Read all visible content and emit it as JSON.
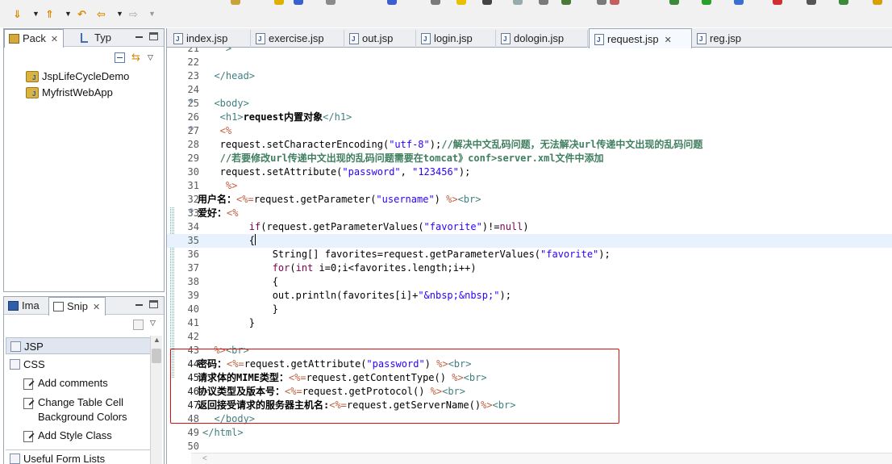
{
  "toolbar": {
    "buttons": [
      {
        "name": "skip-down-button",
        "glyph": "⇓"
      },
      {
        "name": "skip-up-button",
        "glyph": "⇑"
      },
      {
        "name": "back-button",
        "glyph": "⇦"
      },
      {
        "name": "forward-button",
        "glyph": "⇨"
      }
    ]
  },
  "left_top": {
    "tabs": [
      {
        "label": "Pack",
        "active": true,
        "close": "✕"
      },
      {
        "label": "Typ",
        "active": false
      }
    ],
    "projects": [
      "JspLifeCycleDemo",
      "MyfristWebApp"
    ]
  },
  "left_bottom": {
    "tabs": [
      {
        "label": "Ima",
        "active": false
      },
      {
        "label": "Snip",
        "active": true,
        "close": "✕"
      }
    ],
    "drawers": [
      "JSP",
      "CSS",
      "Useful Form Lists"
    ],
    "snippets": [
      "Add comments",
      "Change Table Cell Background Colors",
      "Add Style Class"
    ]
  },
  "editor": {
    "tabs": [
      {
        "label": "index.jsp",
        "active": false
      },
      {
        "label": "exercise.jsp",
        "active": false
      },
      {
        "label": "out.jsp",
        "active": false
      },
      {
        "label": "login.jsp",
        "active": false
      },
      {
        "label": "dologin.jsp",
        "active": false
      },
      {
        "label": "request.jsp",
        "active": true,
        "close": "✕"
      },
      {
        "label": "reg.jsp",
        "active": false
      }
    ],
    "lines": [
      {
        "n": "21",
        "segs": [
          [
            "tag",
            "    >"
          ]
        ]
      },
      {
        "n": "22",
        "segs": []
      },
      {
        "n": "23",
        "segs": [
          [
            "tag",
            "  </head>"
          ]
        ]
      },
      {
        "n": "24",
        "segs": []
      },
      {
        "n": "25",
        "fold": true,
        "segs": [
          [
            "tag",
            "  <body>"
          ]
        ]
      },
      {
        "n": "26",
        "segs": [
          [
            "tag",
            "   <h1>"
          ],
          [
            "txt",
            "request内置对象"
          ],
          [
            "tag",
            "</h1>"
          ]
        ]
      },
      {
        "n": "27",
        "fold": true,
        "segs": [
          [
            "pct",
            "   <%"
          ]
        ]
      },
      {
        "n": "28",
        "segs": [
          [
            "jsp",
            "   request.setCharacterEncoding("
          ],
          [
            "str",
            "\"utf-8\""
          ],
          [
            "jsp",
            ");"
          ],
          [
            "cm",
            "//解决中文乱码问题，无法解决url传递中文出现的乱码问题"
          ]
        ]
      },
      {
        "n": "29",
        "segs": [
          [
            "cm",
            "   //若要修改url传递中文出现的乱码问题需要在tomcat》conf>server.xml文件中添加"
          ]
        ]
      },
      {
        "n": "30",
        "segs": [
          [
            "jsp",
            "   request.setAttribute("
          ],
          [
            "str",
            "\"password\""
          ],
          [
            "jsp",
            ", "
          ],
          [
            "str",
            "\"123456\""
          ],
          [
            "jsp",
            ");"
          ]
        ]
      },
      {
        "n": "31",
        "segs": [
          [
            "pct",
            "    %>"
          ]
        ]
      },
      {
        "n": "32",
        "segs": [
          [
            "txt",
            "用户名："
          ],
          [
            "pct",
            "<%="
          ],
          [
            "jsp",
            "request.getParameter("
          ],
          [
            "str",
            "\"username\""
          ],
          [
            "jsp",
            ") "
          ],
          [
            "pct",
            "%>"
          ],
          [
            "tag",
            "<br>"
          ]
        ],
        "shift": -6
      },
      {
        "n": "33",
        "fold": true,
        "segs": [
          [
            "txt",
            "爱好："
          ],
          [
            "pct",
            "<%"
          ]
        ],
        "shift": -6
      },
      {
        "n": "34",
        "segs": [
          [
            "jsp",
            "        "
          ],
          [
            "kw",
            "if"
          ],
          [
            "jsp",
            "(request.getParameterValues("
          ],
          [
            "str",
            "\"favorite\""
          ],
          [
            "jsp",
            ")!="
          ],
          [
            "kw",
            "null"
          ],
          [
            "jsp",
            ")"
          ]
        ]
      },
      {
        "n": "35",
        "cur": true,
        "segs": [
          [
            "jsp",
            "        {"
          ]
        ],
        "caret": true
      },
      {
        "n": "36",
        "segs": [
          [
            "jsp",
            "            String[] favorites=request.getParameterValues("
          ],
          [
            "str",
            "\"favorite\""
          ],
          [
            "jsp",
            ");"
          ]
        ]
      },
      {
        "n": "37",
        "segs": [
          [
            "jsp",
            "            "
          ],
          [
            "kw",
            "for"
          ],
          [
            "jsp",
            "("
          ],
          [
            "kw",
            "int"
          ],
          [
            "jsp",
            " i=0;i<favorites.length;i++)"
          ]
        ]
      },
      {
        "n": "38",
        "segs": [
          [
            "jsp",
            "            {"
          ]
        ]
      },
      {
        "n": "39",
        "segs": [
          [
            "jsp",
            "            out.println(favorites[i]+"
          ],
          [
            "str",
            "\"&nbsp;&nbsp;\""
          ],
          [
            "jsp",
            ");"
          ]
        ]
      },
      {
        "n": "40",
        "segs": [
          [
            "jsp",
            "            }"
          ]
        ]
      },
      {
        "n": "41",
        "segs": [
          [
            "jsp",
            "        }"
          ]
        ]
      },
      {
        "n": "42",
        "segs": []
      },
      {
        "n": "43",
        "segs": [
          [
            "pct",
            "  %>"
          ],
          [
            "tag",
            "<br>"
          ]
        ]
      },
      {
        "n": "44",
        "dark": true,
        "segs": [
          [
            "txt",
            "密码："
          ],
          [
            "pct",
            "<%="
          ],
          [
            "jsp",
            "request.getAttribute("
          ],
          [
            "str",
            "\"password\""
          ],
          [
            "jsp",
            ") "
          ],
          [
            "pct",
            "%>"
          ],
          [
            "tag",
            "<br>"
          ]
        ],
        "shift": -6
      },
      {
        "n": "45",
        "dark": true,
        "segs": [
          [
            "txt",
            "请求体的MIME类型："
          ],
          [
            "pct",
            "<%="
          ],
          [
            "jsp",
            "request.getContentType() "
          ],
          [
            "pct",
            "%>"
          ],
          [
            "tag",
            "<br>"
          ]
        ],
        "shift": -6
      },
      {
        "n": "46",
        "dark": true,
        "segs": [
          [
            "txt",
            "协议类型及版本号："
          ],
          [
            "pct",
            "<%="
          ],
          [
            "jsp",
            "request.getProtocol() "
          ],
          [
            "pct",
            "%>"
          ],
          [
            "tag",
            "<br>"
          ]
        ],
        "shift": -6
      },
      {
        "n": "47",
        "dark": true,
        "segs": [
          [
            "txt",
            "返回接受请求的服务器主机名:"
          ],
          [
            "pct",
            "<%="
          ],
          [
            "jsp",
            "request.getServerName()"
          ],
          [
            "pct",
            "%>"
          ],
          [
            "tag",
            "<br>"
          ]
        ],
        "shift": -6
      },
      {
        "n": "48",
        "segs": [
          [
            "tag",
            "  </body>"
          ]
        ]
      },
      {
        "n": "49",
        "segs": [
          [
            "tag",
            "</html>"
          ]
        ]
      },
      {
        "n": "50",
        "segs": []
      }
    ]
  }
}
